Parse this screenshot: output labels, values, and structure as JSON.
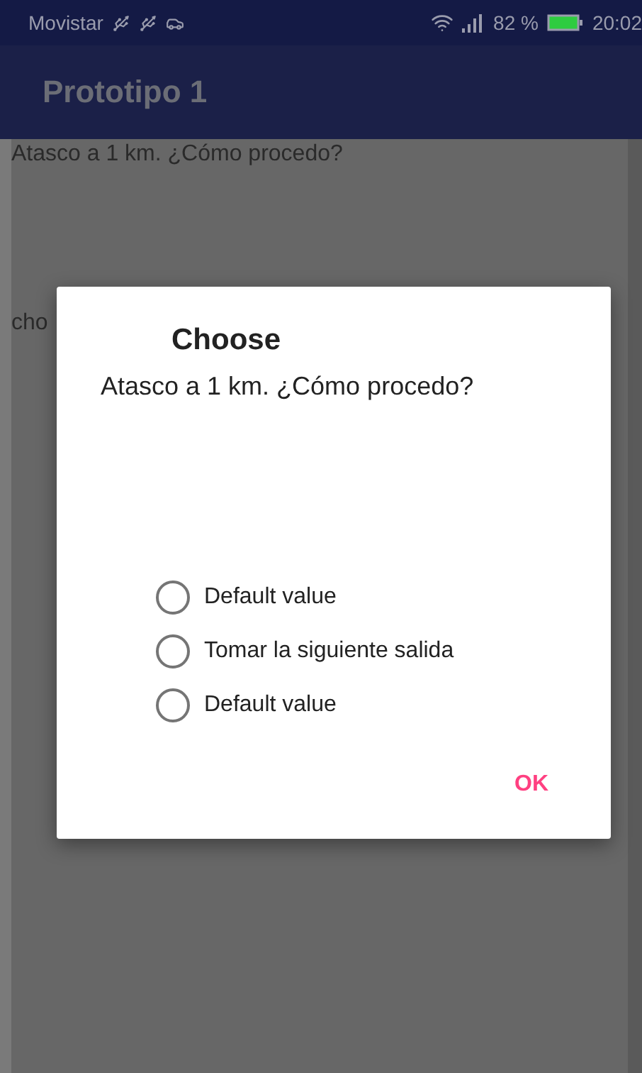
{
  "status_bar": {
    "carrier": "Movistar",
    "battery": "82 %",
    "time": "20:02"
  },
  "app_bar": {
    "title": "Prototipo 1"
  },
  "background": {
    "question": "Atasco a 1 km. ¿Cómo procedo?",
    "partial_label": "cho"
  },
  "dialog": {
    "title": "Choose",
    "message": "Atasco a 1 km. ¿Cómo procedo?",
    "options": [
      {
        "label": "Default value",
        "selected": false
      },
      {
        "label": "Tomar la siguiente salida",
        "selected": false
      },
      {
        "label": "Default value",
        "selected": false
      }
    ],
    "buttons": [
      "OK"
    ]
  }
}
